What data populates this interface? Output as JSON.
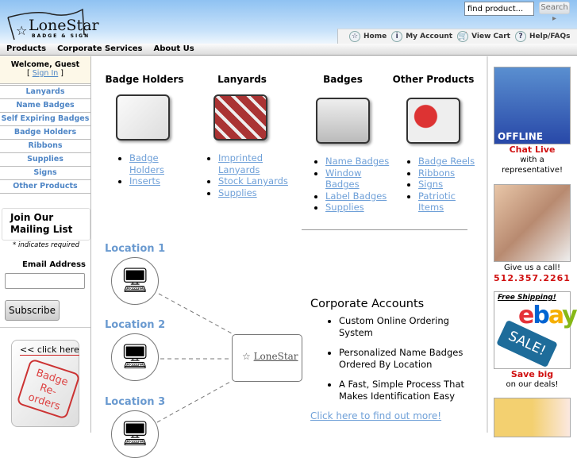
{
  "header": {
    "logo_text": "LoneStar",
    "logo_sub": "BADGE & SIGN",
    "search_placeholder": "find product...",
    "search_button": "Search",
    "tabs": [
      {
        "label": "Home",
        "icon": "star-icon"
      },
      {
        "label": "My Account",
        "icon": "info-icon"
      },
      {
        "label": "View Cart",
        "icon": "cart-icon"
      },
      {
        "label": "Help/FAQs",
        "icon": "help-icon"
      }
    ]
  },
  "menu": [
    "Products",
    "Corporate Services",
    "About Us"
  ],
  "sidebar": {
    "welcome": "Welcome, Guest",
    "sign_in": "Sign In",
    "links": [
      "Lanyards",
      "Name Badges",
      "Self Expiring Badges",
      "Badge Holders",
      "Ribbons",
      "Supplies",
      "Signs",
      "Other Products"
    ],
    "mailing_title": "Join Our Mailing List",
    "required_note": "* indicates required",
    "email_label": "Email Address",
    "subscribe": "Subscribe",
    "click_here": "<< click here",
    "reorder_text": "Badge Re-orders"
  },
  "products": [
    {
      "title": "Badge Holders",
      "links": [
        "Badge Holders",
        "Inserts"
      ]
    },
    {
      "title": "Lanyards",
      "links": [
        "Imprinted Lanyards",
        "Stock Lanyards",
        "Supplies"
      ]
    },
    {
      "title": "Badges",
      "links": [
        "Name Badges",
        "Window Badges",
        "Label Badges",
        "Supplies"
      ]
    },
    {
      "title": "Other Products",
      "links": [
        "Badge Reels",
        "Ribbons",
        "Signs",
        "Patriotic Items"
      ]
    }
  ],
  "corporate": {
    "locations": [
      "Location 1",
      "Location 2",
      "Location 3"
    ],
    "title": "Corporate Accounts",
    "bullets": [
      "Custom Online Ordering System",
      "Personalized Name Badges Ordered By Location",
      "A Fast, Simple Process That Makes Identification Easy"
    ],
    "link": "Click here to find out more!"
  },
  "right": {
    "offline": "OFFLINE",
    "chat": "Chat Live",
    "chat_sub": "with a representative!",
    "call": "Give us a call!",
    "phone": "512.357.2261",
    "free_ship": "Free Shipping!",
    "sale": "SALE!",
    "save": "Save big",
    "save_sub": "on our deals!"
  }
}
